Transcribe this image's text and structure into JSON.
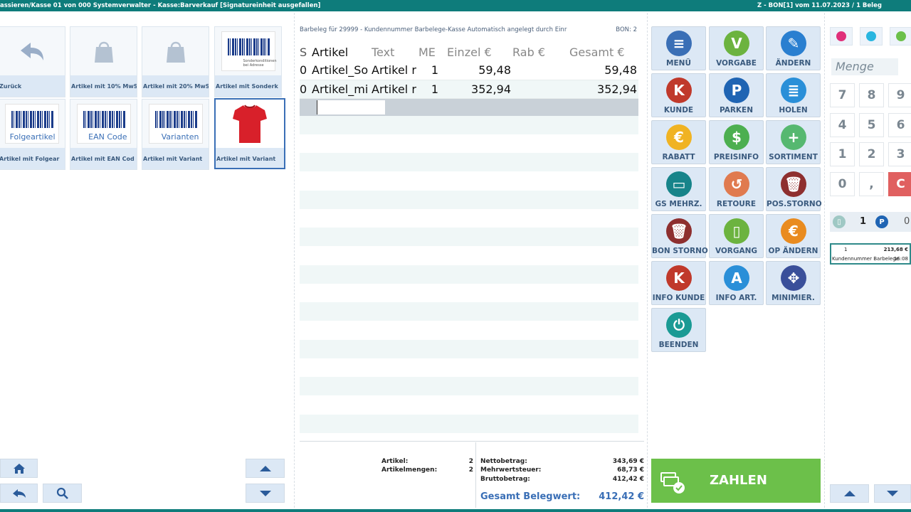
{
  "titlebar": {
    "left": "assieren/Kasse 01 von 000 Systemverwalter - Kasse:Barverkauf [Signatureinheit ausgefallen]",
    "right": "Z - BON[1] vom 11.07.2023 / 1 Beleg"
  },
  "articles": [
    {
      "label": "Zurück"
    },
    {
      "label": "Artikel mit 10% MwS"
    },
    {
      "label": "Artikel mit 20% MwS"
    },
    {
      "label": "Artikel mit Sonderk",
      "small_text": "Sonderkonditionen bei Adresse"
    },
    {
      "label": "Artikel mit Folgear",
      "big_text": "Folgeartikel"
    },
    {
      "label": "Artikel mit EAN Cod",
      "big_text": "EAN Code"
    },
    {
      "label": "Artikel mit Variant",
      "big_text": "Varianten"
    },
    {
      "label": "Artikel mit Variant"
    }
  ],
  "receipt": {
    "info": "Barbeleg für 29999 - Kundennummer Barbelege-Kasse Automatisch angelegt durch Einr",
    "bon": "BON: 2",
    "columns": [
      "S",
      "Artikel",
      "Text",
      "ME",
      "Einzel €",
      "Rab €",
      "Gesamt €"
    ],
    "rows": [
      {
        "s": "0",
        "artikel": "Artikel_So",
        "text": "Artikel r",
        "me": "1",
        "einzel": "59,48",
        "rab": "",
        "gesamt": "59,48"
      },
      {
        "s": "0",
        "artikel": "Artikel_mi",
        "text": "Artikel r",
        "me": "1",
        "einzel": "352,94",
        "rab": "",
        "gesamt": "352,94"
      }
    ]
  },
  "summary": {
    "artikel_label": "Artikel:",
    "artikel_value": "2",
    "mengen_label": "Artikelmengen:",
    "mengen_value": "2",
    "netto_label": "Nettobetrag:",
    "netto_value": "343,69 €",
    "mwst_label": "Mehrwertsteuer:",
    "mwst_value": "68,73 €",
    "brutto_label": "Bruttobetrag:",
    "brutto_value": "412,42 €",
    "total_label": "Gesamt Belegwert:",
    "total_value": "412,42 €"
  },
  "functions": [
    {
      "label": "MENÜ",
      "color": "#3a6fb6",
      "glyph": "≡"
    },
    {
      "label": "VORGABE",
      "color": "#6cb33f",
      "glyph": "V"
    },
    {
      "label": "ÄNDERN",
      "color": "#2a7fd0",
      "glyph": "✎"
    },
    {
      "label": "KUNDE",
      "color": "#c0392b",
      "glyph": "K"
    },
    {
      "label": "PARKEN",
      "color": "#1f64b3",
      "glyph": "P"
    },
    {
      "label": "HOLEN",
      "color": "#2a8fd8",
      "glyph": "≣"
    },
    {
      "label": "RABATT",
      "color": "#f0b323",
      "glyph": "€"
    },
    {
      "label": "PREISINFO",
      "color": "#4caf50",
      "glyph": "$"
    },
    {
      "label": "SORTIMENT",
      "color": "#56b870",
      "glyph": "+"
    },
    {
      "label": "GS MEHRZ.",
      "color": "#17848a",
      "glyph": "▭"
    },
    {
      "label": "RETOURE",
      "color": "#e07a4f",
      "glyph": "↺"
    },
    {
      "label": "POS.STORNO",
      "color": "#8e2f2f",
      "glyph": "🗑"
    },
    {
      "label": "BON STORNO",
      "color": "#8e2f2f",
      "glyph": "🗑"
    },
    {
      "label": "VORGANG",
      "color": "#6cb33f",
      "glyph": "▯"
    },
    {
      "label": "OP ÄNDERN",
      "color": "#e98b1f",
      "glyph": "€"
    },
    {
      "label": "INFO KUNDE",
      "color": "#c0392b",
      "glyph": "K"
    },
    {
      "label": "INFO ART.",
      "color": "#2a8fd8",
      "glyph": "A"
    },
    {
      "label": "MINIMIER.",
      "color": "#3a4f9a",
      "glyph": "✥"
    },
    {
      "label": "BEENDEN",
      "color": "#1a9a94",
      "glyph": "⏻"
    }
  ],
  "pay": {
    "label": "ZAHLEN",
    "color": "#6cc04a"
  },
  "keypad": {
    "placeholder": "Menge",
    "keys": [
      "7",
      "8",
      "9",
      "4",
      "5",
      "6",
      "1",
      "2",
      "3",
      "0",
      ",",
      "C"
    ],
    "top_icons": [
      {
        "name": "pink",
        "color": "#e0307a"
      },
      {
        "name": "cyan",
        "color": "#29b6e0"
      },
      {
        "name": "green",
        "color": "#6cc04a"
      }
    ],
    "counter1": "1",
    "counter2": "0",
    "counter2_badge": "P"
  },
  "bon_card": {
    "number": "1",
    "amount": "213,68 €",
    "customer": "Kundennummer Barbelege",
    "time": "16:08"
  }
}
